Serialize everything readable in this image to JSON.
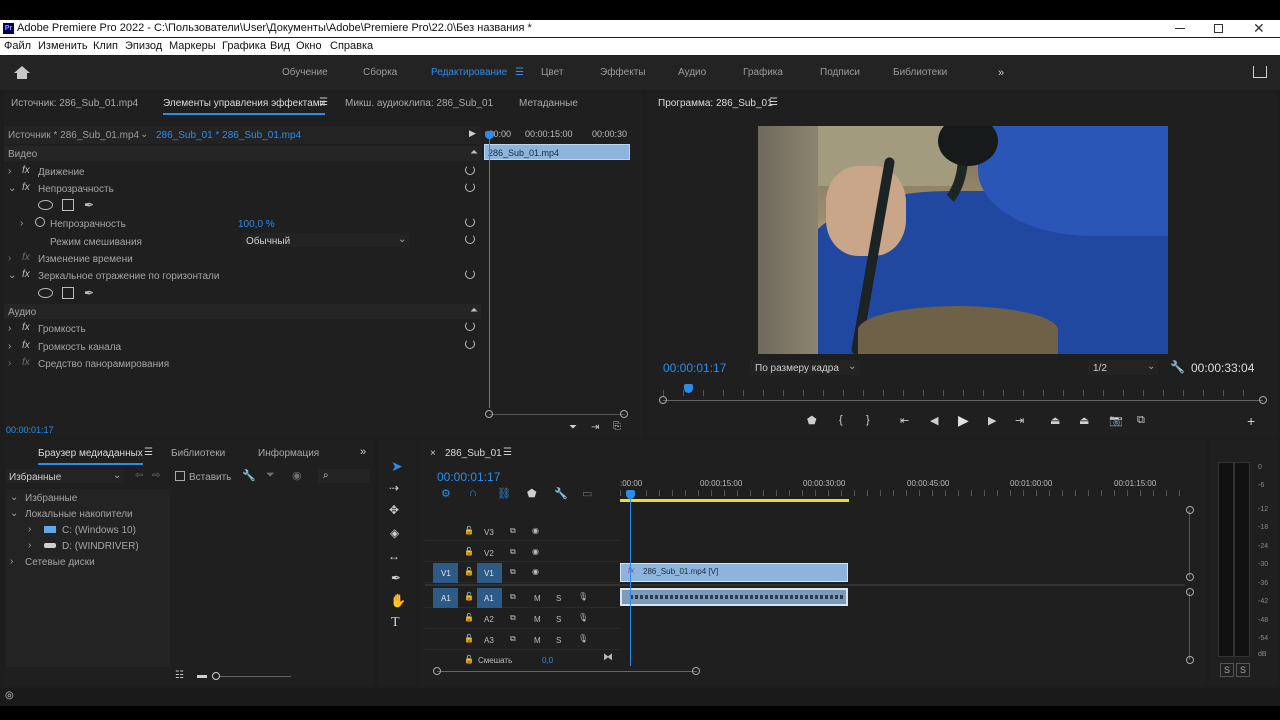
{
  "app": {
    "title": "Adobe Premiere Pro 2022 - C:\\Пользователи\\User\\Документы\\Adobe\\Premiere Pro\\22.0\\Без названия *",
    "icon_text": "Pr"
  },
  "menu": [
    "Файл",
    "Изменить",
    "Клип",
    "Эпизод",
    "Маркеры",
    "Графика",
    "Вид",
    "Окно",
    "Справка"
  ],
  "workspaces": [
    "Обучение",
    "Сборка",
    "Редактирование",
    "Цвет",
    "Эффекты",
    "Аудио",
    "Графика",
    "Подписи",
    "Библиотеки"
  ],
  "source_panel": {
    "tabs": [
      "Источник: 286_Sub_01.mp4",
      "Элементы управления эффектами",
      "Микш. аудиоклипа: 286_Sub_01",
      "Метаданные"
    ],
    "clip_source": "Источник * 286_Sub_01.mp4",
    "clip_seq": "286_Sub_01 * 286_Sub_01.mp4",
    "ruler": [
      ":00:00",
      "00:00:15:00",
      "00:00:30"
    ],
    "clip_name": "286_Sub_01.mp4",
    "sections": {
      "video": "Видео",
      "audio": "Аудио"
    },
    "effects": {
      "motion": "Движение",
      "opacity": "Непрозрачность",
      "opacity_param": "Непрозрачность",
      "opacity_value": "100,0 %",
      "blend_mode": "Режим смешивания",
      "blend_value": "Обычный",
      "time_remap": "Изменение времени",
      "flip": "Зеркальное отражение по горизонтали",
      "volume": "Громкость",
      "channel_volume": "Громкость канала",
      "panner": "Средство панорамирования"
    },
    "timecode": "00:00:01:17"
  },
  "program": {
    "title": "Программа: 286_Sub_01",
    "timecode": "00:00:01:17",
    "fit": "По размеру кадра",
    "quality": "1/2",
    "duration": "00:00:33:04"
  },
  "media_browser": {
    "tabs": [
      "Браузер медиаданных",
      "Библиотеки",
      "Информация"
    ],
    "filter": "Избранные",
    "insert_label": "Вставить",
    "tree": [
      "Избранные",
      "Локальные накопители",
      "C: (Windows 10)",
      "D: (WINDRIVER)",
      "Сетевые диски"
    ]
  },
  "timeline": {
    "seq_name": "286_Sub_01",
    "timecode": "00:00:01:17",
    "ruler": [
      ":00:00",
      "00:00:15:00",
      "00:00:30:00",
      "00:00:45:00",
      "00:01:00:00",
      "00:01:15:00"
    ],
    "tracks": {
      "v3": "V3",
      "v2": "V2",
      "v1": "V1",
      "a1": "A1",
      "a2": "A2",
      "a3": "A3",
      "src_v": "V1",
      "src_a": "A1",
      "m": "M",
      "s": "S"
    },
    "video_clip": "286_Sub_01.mp4 [V]",
    "mix_label": "Смешать",
    "mix_value": "0,0"
  },
  "meter": {
    "ticks": [
      "0",
      "-6",
      "-12",
      "-18",
      "-24",
      "-30",
      "-36",
      "-42",
      "-48",
      "-54",
      "dB"
    ],
    "solo": "S"
  }
}
